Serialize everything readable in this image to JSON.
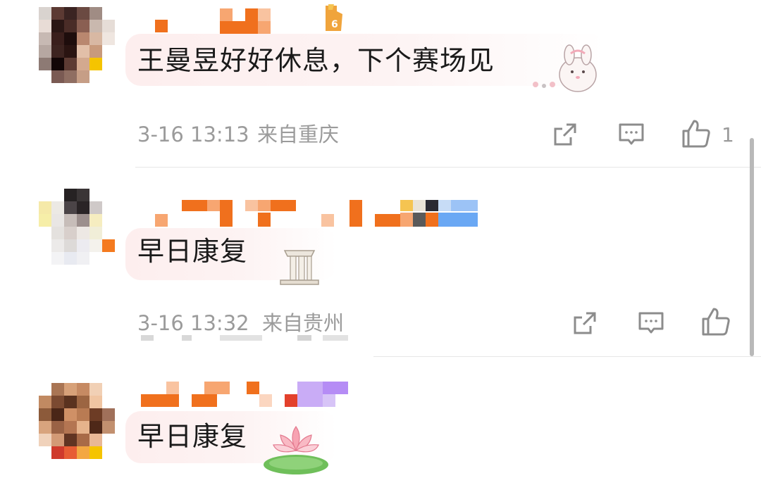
{
  "comments": [
    {
      "text": "王曼昱好好休息，下个赛场见",
      "time": "3-16 13:13",
      "location": "来自重庆",
      "like_count": "1",
      "level_badge": "6",
      "sticker": "bunny-hugging-sticker"
    },
    {
      "text": "早日康复",
      "time": "3-16 13:32",
      "location": "来自贵州",
      "like_count": "",
      "sticker": "ancient-column-sticker"
    },
    {
      "text": "早日康复",
      "sticker": "lotus-sticker"
    }
  ],
  "icons": {
    "share": "share-icon",
    "reply": "comment-icon",
    "like": "thumbs-up-icon"
  },
  "colors": {
    "meta_text": "#9b9b9b",
    "comment_text": "#1a1a1a",
    "bubble": "#fdeeee",
    "username_orange": "#f0701d",
    "username_blue": "#6aa8f4",
    "username_purple": "#b58cf5"
  }
}
